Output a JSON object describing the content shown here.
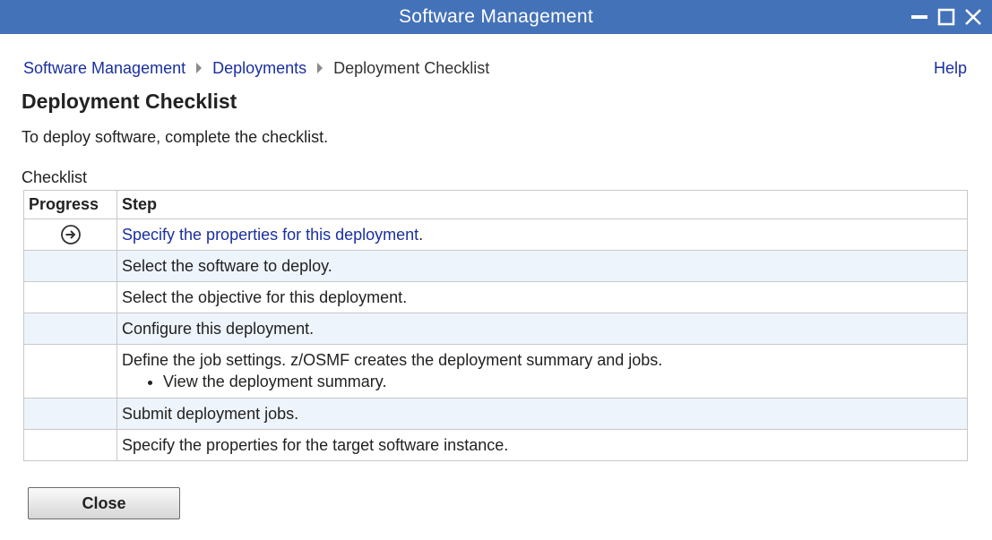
{
  "window": {
    "title": "Software Management",
    "controls": [
      "minimize-icon",
      "maximize-icon",
      "close-icon"
    ],
    "title_bar_color": "#4472b8"
  },
  "breadcrumb": {
    "items": [
      "Software Management",
      "Deployments"
    ],
    "current": "Deployment Checklist"
  },
  "help_label": "Help",
  "page": {
    "title": "Deployment Checklist",
    "intro": "To deploy software, complete the checklist."
  },
  "checklist": {
    "caption": "Checklist",
    "headers": [
      "Progress",
      "Step"
    ],
    "rows": [
      {
        "step": "Specify the properties for this deployment",
        "suffix": ".",
        "is_link": true,
        "progress_icon": "arrow-circle-right-icon"
      },
      {
        "step": "Select the software to deploy.",
        "is_link": false
      },
      {
        "step": "Select the objective for this deployment.",
        "is_link": false
      },
      {
        "step": "Configure this deployment.",
        "is_link": false
      },
      {
        "step": "Define the job settings. z/OSMF creates the deployment summary and jobs.",
        "sub_items": [
          "View the deployment summary."
        ],
        "is_link": false
      },
      {
        "step": "Submit deployment jobs.",
        "is_link": false
      },
      {
        "step": "Specify the properties for the target software instance.",
        "is_link": false
      }
    ]
  },
  "buttons": {
    "close_label": "Close"
  },
  "colors": {
    "link": "#1a2fa0",
    "row_alt": "#eef4fb"
  }
}
